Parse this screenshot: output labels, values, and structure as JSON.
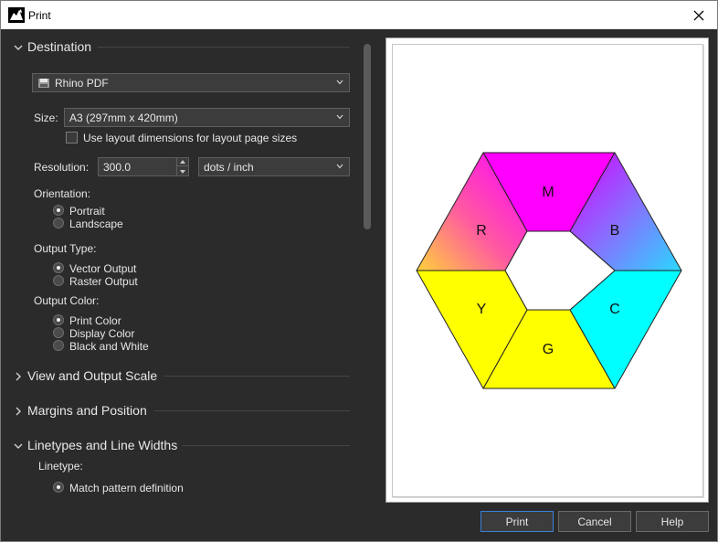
{
  "window": {
    "title": "Print"
  },
  "destination": {
    "header": "Destination",
    "printer": "Rhino PDF",
    "size_label": "Size:",
    "size_value": "A3 (297mm x 420mm)",
    "layout_dims_label": "Use layout dimensions for layout page sizes",
    "resolution_label": "Resolution:",
    "resolution_value": "300.0",
    "resolution_unit": "dots / inch",
    "orientation_label": "Orientation:",
    "orientation_options": [
      "Portrait",
      "Landscape"
    ],
    "output_type_label": "Output Type:",
    "output_type_options": [
      "Vector Output",
      "Raster Output"
    ],
    "output_color_label": "Output Color:",
    "output_color_options": [
      "Print Color",
      "Display Color",
      "Black and White"
    ]
  },
  "sections": {
    "view_scale": "View and Output Scale",
    "margins": "Margins and Position",
    "linetypes": "Linetypes and Line Widths"
  },
  "linetypes": {
    "linetype_label": "Linetype:",
    "option": "Match pattern definition"
  },
  "preview": {
    "segments": [
      "M",
      "B",
      "C",
      "G",
      "Y",
      "R"
    ]
  },
  "buttons": {
    "print": "Print",
    "cancel": "Cancel",
    "help": "Help"
  },
  "colors": {
    "magenta": "#ff00ff",
    "cyan": "#00ffff",
    "yellow": "#ffff00",
    "accent": "#3d7fd9"
  }
}
